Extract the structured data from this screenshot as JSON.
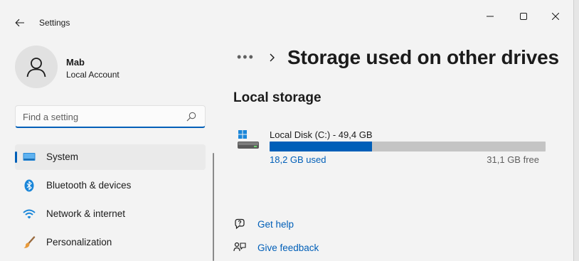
{
  "window": {
    "title": "Settings",
    "controls": [
      "minimize",
      "maximize",
      "close"
    ]
  },
  "user": {
    "name": "Mab",
    "account_type": "Local Account"
  },
  "search": {
    "placeholder": "Find a setting",
    "value": ""
  },
  "sidebar": {
    "items": [
      {
        "label": "System",
        "icon": "system-icon",
        "active": true
      },
      {
        "label": "Bluetooth & devices",
        "icon": "bluetooth-icon",
        "active": false
      },
      {
        "label": "Network & internet",
        "icon": "wifi-icon",
        "active": false
      },
      {
        "label": "Personalization",
        "icon": "brush-icon",
        "active": false
      }
    ]
  },
  "main": {
    "breadcrumb_more": "•••",
    "title": "Storage used on other drives",
    "section_title": "Local storage",
    "drive": {
      "name": "Local Disk (C:) - 49,4 GB",
      "used_label": "18,2 GB used",
      "free_label": "31,1 GB free",
      "used_fraction": 0.37
    },
    "links": [
      {
        "label": "Get help",
        "icon": "help-icon"
      },
      {
        "label": "Give feedback",
        "icon": "feedback-icon"
      }
    ]
  },
  "colors": {
    "accent": "#005fb8",
    "background": "#f3f3f3",
    "bar_track": "#c4c4c4"
  }
}
